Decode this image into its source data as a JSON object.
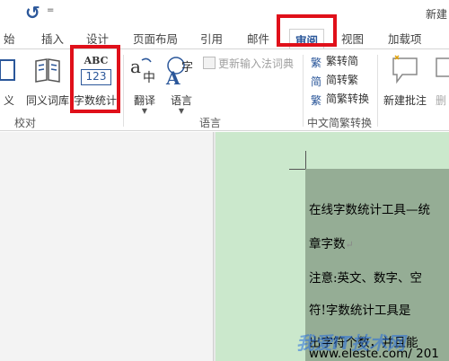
{
  "titlebar": {
    "undo_glyph": "↺",
    "more_glyph": "=",
    "doc_title": "新建"
  },
  "tabs": [
    "始",
    "插入",
    "设计",
    "页面布局",
    "引用",
    "邮件",
    "审阅",
    "视图",
    "加载项"
  ],
  "ribbon": {
    "proofing": {
      "partial_label": "义",
      "thesaurus": "同义词库",
      "word_count": "字数统计",
      "word_count_icon_top": "ABC",
      "word_count_icon_bottom": "123",
      "group_label": "校对"
    },
    "language": {
      "translate": "翻译",
      "language": "语言",
      "update_ime": "更新输入法词典",
      "group_label": "语言"
    },
    "chinese_conversion": {
      "to_simplified": "繁转简",
      "to_traditional": "简转繁",
      "convert": "简繁转换",
      "group_label": "中文简繁转换"
    },
    "comments": {
      "new_comment": "新建批注",
      "delete_partial": "删"
    }
  },
  "document": {
    "lines": [
      "在线字数统计工具—统",
      "章字数",
      "注意:英文、数字、空",
      "符!字数统计工具是",
      "出字符个数，并且能",
      "www.eleste.com/ 201"
    ],
    "watermark": "我爱IT技术网"
  },
  "colors": {
    "highlight": "#e0101a",
    "accent": "#2b579a",
    "page": "#cbe8cc",
    "text_block": "#95ad95"
  }
}
